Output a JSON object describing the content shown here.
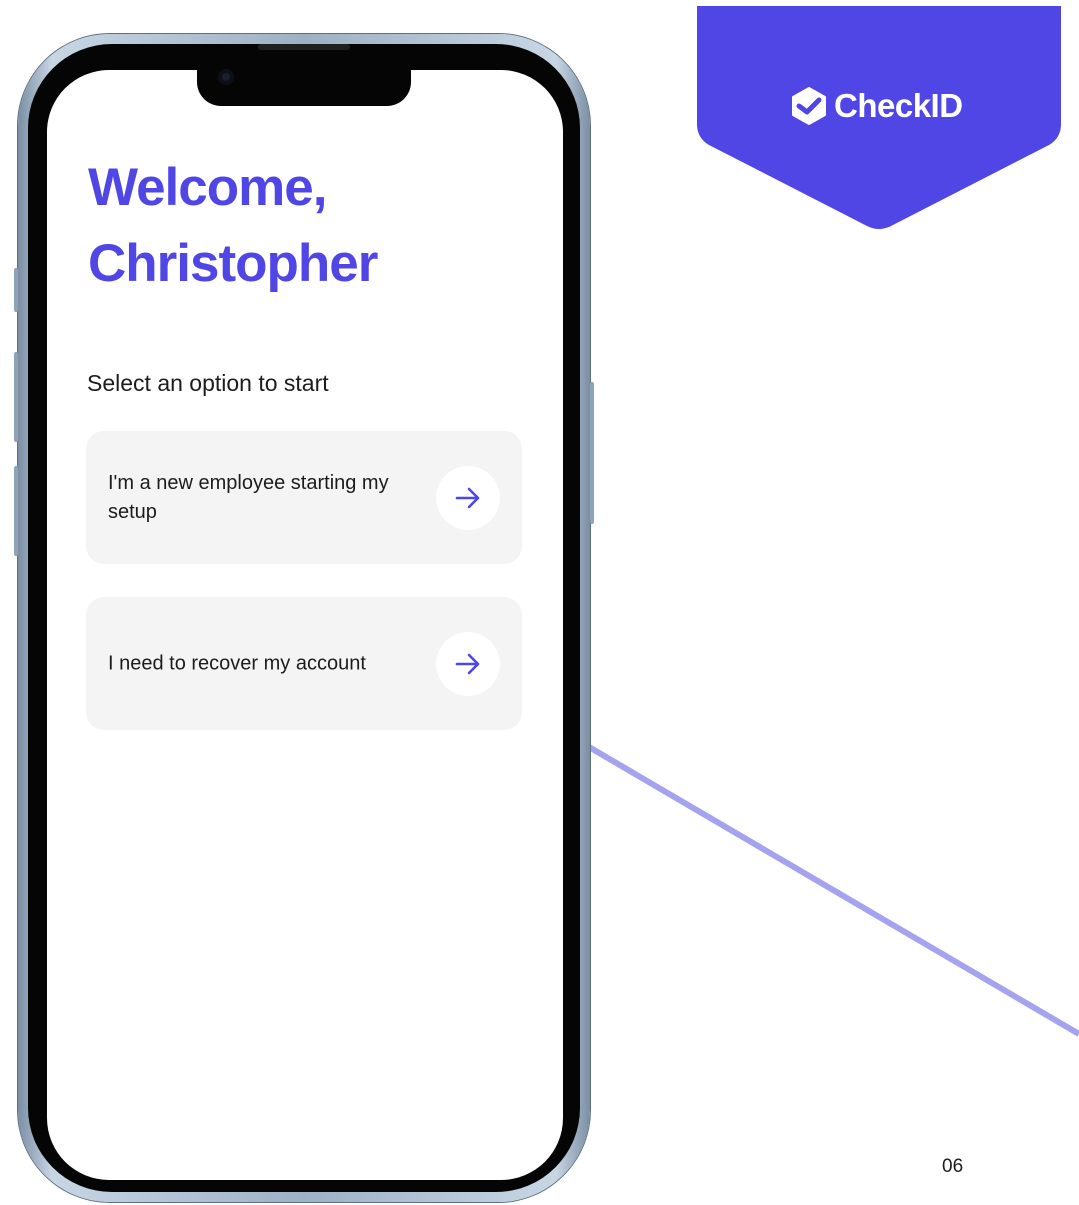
{
  "brand": {
    "name": "CheckID",
    "color": "#4f46e5",
    "logo_icon": "checkid-shield-icon"
  },
  "screen": {
    "welcome_line1": "Welcome,",
    "welcome_line2": "Christopher",
    "prompt": "Select an option to start",
    "options": [
      {
        "label": "I'm a new employee starting my setup",
        "icon": "arrow-right-icon"
      },
      {
        "label": "I need to recover my account",
        "icon": "arrow-right-icon"
      }
    ]
  },
  "page_number": "06"
}
